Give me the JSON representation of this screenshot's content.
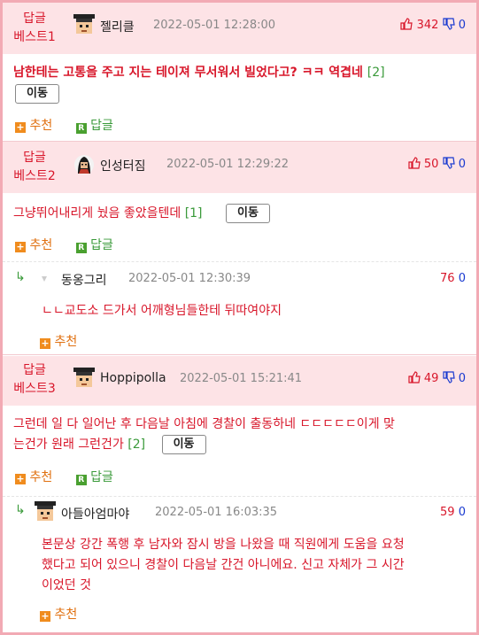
{
  "comments": [
    {
      "best_label_1": "답글",
      "best_label_2": "베스트1",
      "nickname": "젤리클",
      "date": "2022-05-01 12:28:00",
      "up": "342",
      "down": "0",
      "text": "남한테는 고통을 주고 지는 테이져 무서워서 빌었다고? ㅋㅋ 역겹네",
      "reply_count": "[2]",
      "move_label": "이동",
      "recommend_label": "추천",
      "reply_label": "답글"
    },
    {
      "best_label_1": "답글",
      "best_label_2": "베스트2",
      "nickname": "인성터짐",
      "date": "2022-05-01 12:29:22",
      "up": "50",
      "down": "0",
      "text": "그냥뛰어내리게 눴음 좋았을텐데",
      "reply_count": "[1]",
      "move_label": "이동",
      "recommend_label": "추천",
      "reply_label": "답글",
      "reply": {
        "nickname": "동옹그리",
        "date": "2022-05-01 12:30:39",
        "up": "76",
        "down": "0",
        "text": "ㄴㄴ교도소 드가서 어깨형님들한테 뒤따여야지",
        "recommend_label": "추천"
      }
    },
    {
      "best_label_1": "답글",
      "best_label_2": "베스트3",
      "nickname": "Hoppipolla",
      "date": "2022-05-01 15:21:41",
      "up": "49",
      "down": "0",
      "text_line1": "그런데 일 다 일어난 후 다음날 아침에 경찰이 출동하네 ㄷㄷㄷㄷㄷ이게 맞",
      "text_line2": "는건가 원래 그런건가",
      "reply_count": "[2]",
      "move_label": "이동",
      "recommend_label": "추천",
      "reply_label": "답글",
      "reply": {
        "nickname": "아들아엄마야",
        "date": "2022-05-01 16:03:35",
        "up": "59",
        "down": "0",
        "text_line1": "본문상 강간 폭행 후 남자와 잠시 방을 나왔을 때 직원에게 도움을 요청",
        "text_line2": "했다고 되어 있으니 경찰이 다음날 간건 아니에요. 신고 자체가 그 시간",
        "text_line3": "이었던 것",
        "recommend_label": "추천"
      }
    }
  ],
  "colors": {
    "header_bg": "#fde3e6",
    "frame": "#f2aab4",
    "accent_red": "#d8162a",
    "accent_blue": "#1a3ad0",
    "accent_green": "#3a9a3a",
    "accent_orange": "#e07010"
  },
  "icons": {
    "thumb_up": "thumb-up-icon",
    "thumb_down": "thumb-down-icon",
    "plus": "plus-icon",
    "reply_r": "reply-r-icon",
    "reply_arrow": "reply-arrow-icon"
  }
}
